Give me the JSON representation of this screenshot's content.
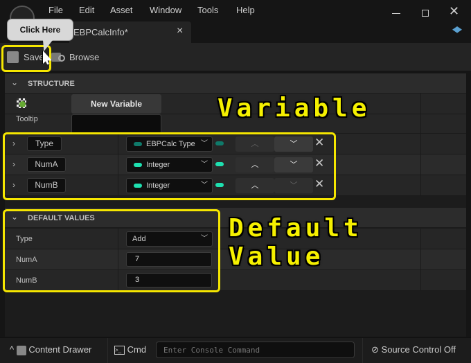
{
  "menu": [
    "File",
    "Edit",
    "Asset",
    "Window",
    "Tools",
    "Help"
  ],
  "tab": {
    "title": "EBPCalcInfo*",
    "close": "×"
  },
  "toolbar": {
    "save": "Save",
    "browse": "Browse"
  },
  "callout": "Click Here",
  "structure": {
    "header": "STRUCTURE",
    "new_variable": "New Variable",
    "tooltip_label": "Tooltip",
    "tooltip_value": "",
    "variables": [
      {
        "name": "Type",
        "type": "EBPCalc Type",
        "color": "#0f7a6a",
        "up_enabled": false,
        "down_enabled": true
      },
      {
        "name": "NumA",
        "type": "Integer",
        "color": "#1ee0b0",
        "up_enabled": true,
        "down_enabled": true
      },
      {
        "name": "NumB",
        "type": "Integer",
        "color": "#1ee0b0",
        "up_enabled": true,
        "down_enabled": false
      }
    ]
  },
  "defaults": {
    "header": "DEFAULT VALUES",
    "rows": [
      {
        "label": "Type",
        "value": "Add"
      },
      {
        "label": "NumA",
        "value": "7"
      },
      {
        "label": "NumB",
        "value": "3"
      }
    ]
  },
  "annotations": {
    "variable": "Variable",
    "default_value": "Default Value"
  },
  "status": {
    "content_drawer": "Content Drawer",
    "cmd": "Cmd",
    "console_placeholder": "Enter Console Command",
    "source_control": "Source Control Off"
  }
}
